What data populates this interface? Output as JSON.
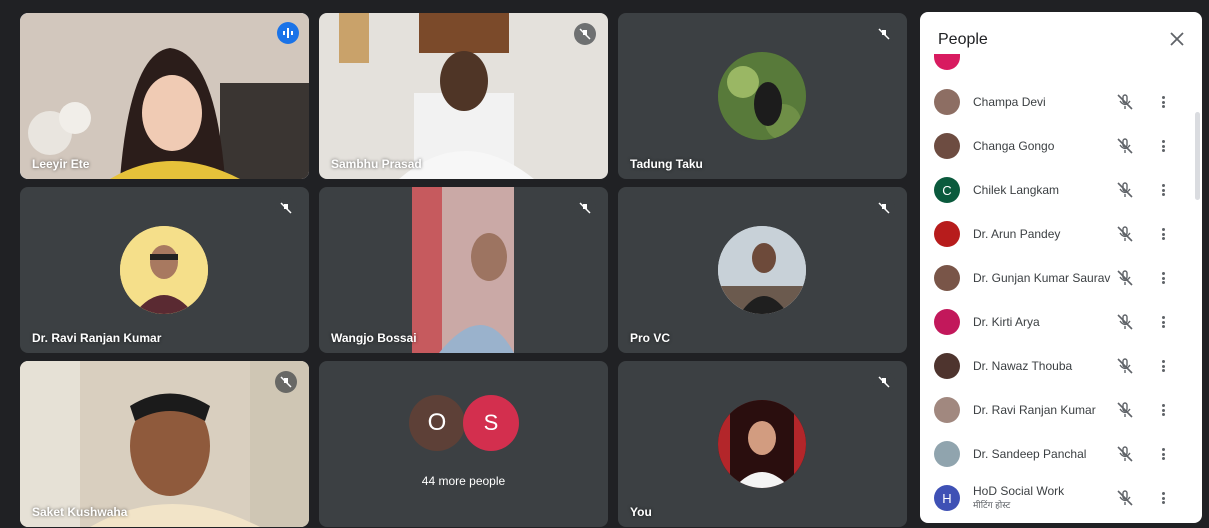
{
  "tiles": [
    {
      "name": "Leeyir Ete",
      "state": "speaking"
    },
    {
      "name": "Sambhu Prasad",
      "state": "muted"
    },
    {
      "name": "Tadung Taku",
      "state": "muted"
    },
    {
      "name": "Dr. Ravi Ranjan Kumar",
      "state": "muted"
    },
    {
      "name": "Wangjo Bossai",
      "state": "muted"
    },
    {
      "name": "Pro VC",
      "state": "muted"
    },
    {
      "name": "Saket Kushwaha",
      "state": "muted"
    },
    {
      "name": "44 more people",
      "avatars": [
        "O",
        "S"
      ]
    },
    {
      "name": "You",
      "state": "muted"
    }
  ],
  "people_panel": {
    "title": "People",
    "participants": [
      {
        "name": "Champa Devi"
      },
      {
        "name": "Changa Gongo"
      },
      {
        "name": "Chilek Langkam",
        "initial": "C",
        "color": "#0b5a3d"
      },
      {
        "name": "Dr. Arun Pandey"
      },
      {
        "name": "Dr. Gunjan Kumar Saurav"
      },
      {
        "name": "Dr. Kirti Arya"
      },
      {
        "name": "Dr. Nawaz Thouba"
      },
      {
        "name": "Dr. Ravi Ranjan Kumar"
      },
      {
        "name": "Dr. Sandeep Panchal"
      },
      {
        "name": "HoD Social Work",
        "subtitle": "मीटिंग होस्ट",
        "initial": "H",
        "color": "#3f51b5"
      }
    ]
  },
  "colors": {
    "tile_bg": "#3c4043",
    "page_bg": "#202124",
    "active_border": "#8ab4f8",
    "speaking": "#1a73e8"
  }
}
